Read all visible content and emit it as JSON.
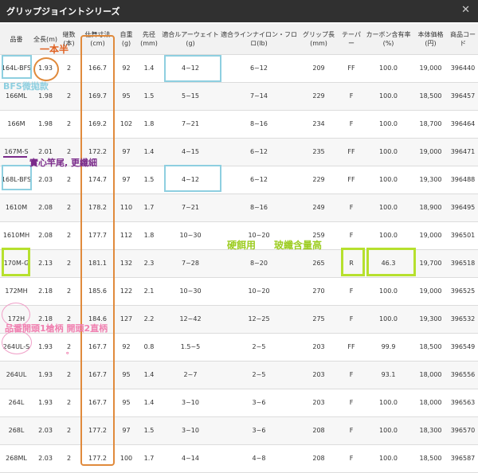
{
  "title": "グリップジョイントシリーズ",
  "close_glyph": "✕",
  "headers": [
    "品番",
    "全長(m)",
    "継数(本)",
    "仕舞寸法(cm)",
    "自重(g)",
    "先径(mm)",
    "適合ルアーウェイト(g)",
    "適合ラインナイロン・フロロ(lb)",
    "グリップ長(mm)",
    "テーパー",
    "カーボン含有率(%)",
    "本体価格(円)",
    "商品コード"
  ],
  "rows": [
    [
      "164L-BFS",
      "1.93",
      "2",
      "166.7",
      "92",
      "1.4",
      "4~12",
      "6~12",
      "209",
      "FF",
      "100.0",
      "19,000",
      "396440"
    ],
    [
      "166ML",
      "1.98",
      "2",
      "169.7",
      "95",
      "1.5",
      "5~15",
      "7~14",
      "229",
      "F",
      "100.0",
      "18,500",
      "396457"
    ],
    [
      "166M",
      "1.98",
      "2",
      "169.2",
      "102",
      "1.8",
      "7~21",
      "8~16",
      "234",
      "F",
      "100.0",
      "18,700",
      "396464"
    ],
    [
      "167M-S",
      "2.01",
      "2",
      "172.2",
      "97",
      "1.4",
      "4~15",
      "6~12",
      "235",
      "FF",
      "100.0",
      "19,000",
      "396471"
    ],
    [
      "168L-BFS",
      "2.03",
      "2",
      "174.7",
      "97",
      "1.5",
      "4~12",
      "6~12",
      "229",
      "FF",
      "100.0",
      "19,300",
      "396488"
    ],
    [
      "1610M",
      "2.08",
      "2",
      "178.2",
      "110",
      "1.7",
      "7~21",
      "8~16",
      "249",
      "F",
      "100.0",
      "18,900",
      "396495"
    ],
    [
      "1610MH",
      "2.08",
      "2",
      "177.7",
      "112",
      "1.8",
      "10~30",
      "10~20",
      "259",
      "F",
      "100.0",
      "19,000",
      "396501"
    ],
    [
      "170M-G",
      "2.13",
      "2",
      "181.1",
      "132",
      "2.3",
      "7~28",
      "8~20",
      "265",
      "R",
      "46.3",
      "19,700",
      "396518"
    ],
    [
      "172MH",
      "2.18",
      "2",
      "185.6",
      "122",
      "2.1",
      "10~30",
      "10~20",
      "270",
      "F",
      "100.0",
      "19,000",
      "396525"
    ],
    [
      "172H",
      "2.18",
      "2",
      "184.6",
      "127",
      "2.2",
      "12~42",
      "12~25",
      "275",
      "F",
      "100.0",
      "19,300",
      "396532"
    ],
    [
      "264UL-S",
      "1.93",
      "2",
      "167.7",
      "92",
      "0.8",
      "1.5~5",
      "2~5",
      "203",
      "FF",
      "99.9",
      "18,500",
      "396549"
    ],
    [
      "264UL",
      "1.93",
      "2",
      "167.7",
      "95",
      "1.4",
      "2~7",
      "2~5",
      "203",
      "F",
      "93.1",
      "18,000",
      "396556"
    ],
    [
      "264L",
      "1.93",
      "2",
      "167.7",
      "95",
      "1.4",
      "3~10",
      "3~6",
      "203",
      "F",
      "100.0",
      "18,000",
      "396563"
    ],
    [
      "268L",
      "2.03",
      "2",
      "177.2",
      "97",
      "1.5",
      "3~10",
      "3~6",
      "208",
      "F",
      "100.0",
      "18,300",
      "396570"
    ],
    [
      "268ML",
      "2.03",
      "2",
      "177.2",
      "100",
      "1.7",
      "4~14",
      "4~8",
      "208",
      "F",
      "100.0",
      "18,500",
      "396587"
    ]
  ],
  "annotations": {
    "one_and_half": "一本半",
    "bfs": "BFS微拋款",
    "solid_tip": "實心竿尾, 更纖細",
    "hard_bait": "硬餌用",
    "glass_fiber": "玻纖含量高",
    "model_note": "品番開頭1槍柄 開頭2直柄",
    "dot": "。"
  },
  "colors": {
    "titlebar": "#303030",
    "blue": "#8ecfe0",
    "orange": "#e08a3c",
    "lime": "#b6e02e",
    "pink": "#f0a0c8",
    "purple": "#7a2a8a",
    "orange_text": "#e06020",
    "green_text": "#9ccc20",
    "pink_text": "#f080b0"
  }
}
